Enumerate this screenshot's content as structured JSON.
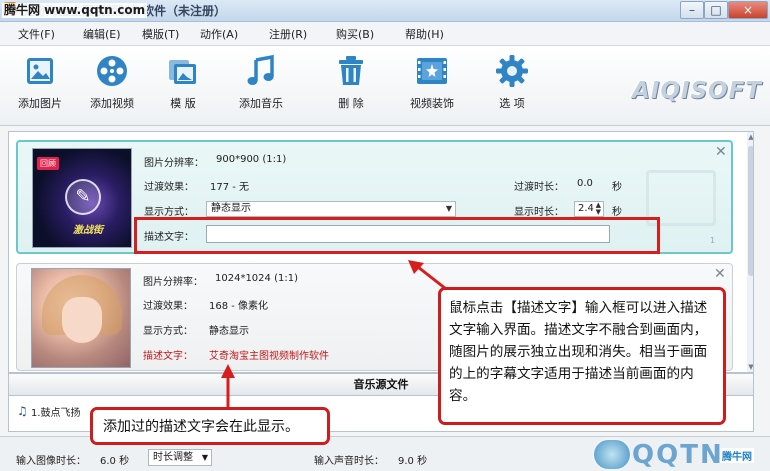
{
  "window": {
    "title": "艾奇淘宝主图视频制作软件（未注册）",
    "watermark": "腾牛网 www.qqtn.com",
    "minimize_label": "–",
    "restore_label": "□",
    "close_label": "×"
  },
  "menu": {
    "items": [
      {
        "label": "文件(F)"
      },
      {
        "label": "编辑(E)"
      },
      {
        "label": "模版(T)"
      },
      {
        "label": "动作(A)"
      },
      {
        "label": "注册(R)"
      },
      {
        "label": "购买(B)"
      },
      {
        "label": "帮助(H)"
      }
    ]
  },
  "toolbar": {
    "items": [
      {
        "label": "添加图片",
        "icon": "add-image-icon"
      },
      {
        "label": "添加视频",
        "icon": "film-reel-icon"
      },
      {
        "label": "模  版",
        "icon": "template-icon"
      },
      {
        "label": "添加音乐",
        "icon": "music-note-icon"
      },
      {
        "label": "删  除",
        "icon": "trash-icon"
      },
      {
        "label": "视频装饰",
        "icon": "decorate-icon"
      },
      {
        "label": "选  项",
        "icon": "gear-icon"
      }
    ],
    "brand": "AIQISOFT"
  },
  "items": [
    {
      "resolution_label": "图片分辨率：",
      "resolution": "900*900 (1:1)",
      "transition_label": "过渡效果：",
      "transition": "177 -  无",
      "display_label": "显示方式：",
      "display_mode": "静态显示",
      "transition_duration_label": "过渡时长：",
      "transition_duration": "0.0",
      "duration_label": "显示时长：",
      "duration": "2.4",
      "unit": "秒",
      "desc_label": "描述文字：",
      "desc_value": "",
      "thumb_badge": "回顾",
      "thumb_caption": "激战街",
      "counter": "1"
    },
    {
      "resolution_label": "图片分辨率：",
      "resolution": "1024*1024 (1:1)",
      "transition_label": "过渡效果：",
      "transition": "168 -  像素化",
      "display_label": "显示方式：",
      "display_mode": "静态显示",
      "desc_label": "描述文字：",
      "desc_value": "艾奇淘宝主图视频制作软件"
    }
  ],
  "music": {
    "header": "音乐源文件",
    "items": [
      {
        "label": "1.鼓点飞扬"
      }
    ]
  },
  "status": {
    "image_duration_label": "输入图像时长：",
    "image_duration": "6.0 秒",
    "duration_adjust": "时长调整",
    "audio_duration_label": "输入声音时长：",
    "audio_duration": "9.0 秒"
  },
  "callouts": {
    "main": "鼠标点击【描述文字】输入框可以进入描述文字输入界面。描述文字不融合到画面内，随图片的展示独立出现和消失。相当于画面的上的字幕文字适用于描述当前画面的内容。",
    "bottom": "添加过的描述文字会在此显示。"
  },
  "watermark_bottom": {
    "text": "QQTN",
    "small": "腾牛网"
  },
  "colors": {
    "highlight": "#d71d1d",
    "selected_item_border": "#6cc7c9",
    "description_text": "#c31818"
  }
}
